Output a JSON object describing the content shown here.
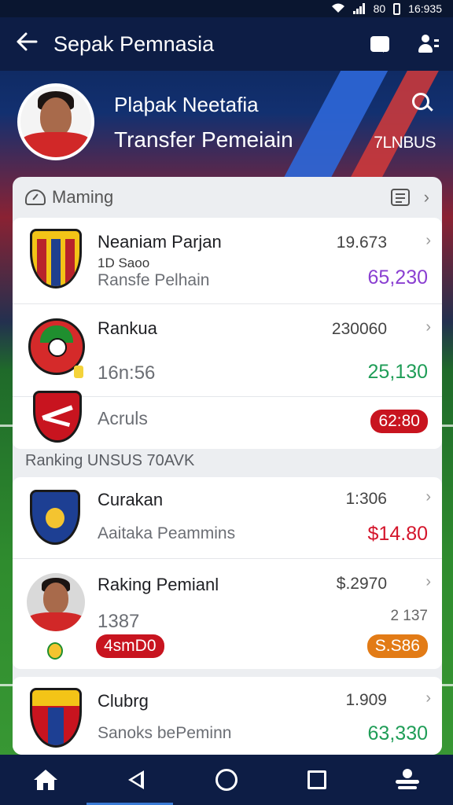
{
  "status_bar": {
    "battery_level": "80",
    "time": "16:935"
  },
  "app_bar": {
    "title": "Sepak Pemnasia"
  },
  "profile": {
    "name": "Plaþak Neetafia",
    "subtitle": "Transfer Pemeiain",
    "tag": "7LNBUS"
  },
  "panel": {
    "header_label": "Maming",
    "group1": [
      {
        "name": "Neaniam Parjan",
        "sub": "1D Saoo",
        "muted": "Ransfe Pelhain",
        "number": "19.673",
        "price": "65,230",
        "price_color": "#8a3fd1",
        "crest_colors": [
          "#f3c417",
          "#b8232b",
          "#1f3f8e"
        ]
      },
      {
        "name": "Rankua",
        "muted": "16n:56",
        "number": "230060",
        "price": "25,130",
        "price_color": "#1f9d57",
        "crest_colors": [
          "#1f8f2f",
          "#d52a2a",
          "#f4d33a"
        ]
      },
      {
        "muted": "Acruls",
        "pill": "62:80",
        "pill_color": "#c8141f",
        "crest_colors": [
          "#c8141f",
          "#ffffff"
        ]
      }
    ],
    "section_label": "Ranking UNSUS 70AVK",
    "group2": [
      {
        "name": "Curakan",
        "muted": "Aaitaka Peammins",
        "number": "1:306",
        "price": "$14.80",
        "price_color": "#d4152b",
        "crest_colors": [
          "#1d3f93",
          "#f4c430"
        ]
      },
      {
        "name": "Raking Pemianl",
        "muted": "1387",
        "number": "$.2970",
        "number2": "2 137",
        "pill": "4smD0",
        "pill_color": "#c8141f",
        "pill2": "S.S86",
        "pill2_color": "#e27b16"
      }
    ],
    "group3": [
      {
        "name": "Clubrg",
        "muted": "Sanoks bePeminn",
        "number": "1.909",
        "price": "63,330",
        "price_color": "#1f9d57",
        "crest_colors": [
          "#f3c417",
          "#c8141f",
          "#1d3f93"
        ]
      }
    ]
  },
  "icons": {
    "back": "arrow-left-icon",
    "chat": "chat-icon",
    "user": "user-icon",
    "search": "search-icon",
    "gauge": "gauge-icon",
    "note": "note-icon",
    "home": "home-icon",
    "back_nav": "triangle-back-icon",
    "home_nav": "circle-home-icon",
    "recents": "square-recents-icon",
    "account": "account-icon"
  }
}
